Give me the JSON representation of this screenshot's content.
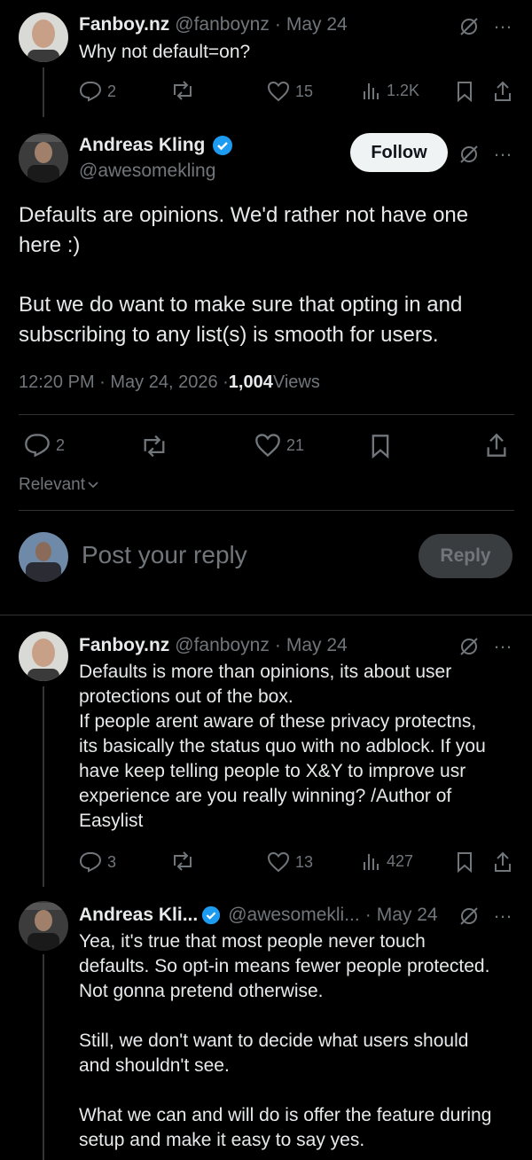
{
  "tweet1": {
    "name": "Fanboy.nz",
    "handle": "@fanboynz",
    "sep": "·",
    "date": "May 24",
    "text": "Why not default=on?",
    "replies": "2",
    "likes": "15",
    "views": "1.2K"
  },
  "main": {
    "name": "Andreas Kling",
    "handle": "@awesomekling",
    "follow_label": "Follow",
    "text_line1": "Defaults are opinions. We'd rather not have one",
    "text_line2": "here :)",
    "text_line3": "But we do want to make sure that opting in and",
    "text_line4": "subscribing to any list(s) is smooth for users.",
    "time": "12:20 PM · May 24, 2026 · ",
    "views_count": "1,004",
    "views_label": " Views",
    "replies": "2",
    "likes": "21"
  },
  "sort": {
    "label": "Relevant"
  },
  "composer": {
    "placeholder": "Post your reply",
    "reply_label": "Reply"
  },
  "tweet2": {
    "name": "Fanboy.nz",
    "handle": "@fanboynz",
    "sep": "·",
    "date": "May 24",
    "line1": "Defaults is more than opinions, its about user",
    "line2": "protections out of the box.",
    "line3": "If people arent aware of these privacy protectns,",
    "line4": "its basically the status quo with no adblock. If you",
    "line5": "have keep telling people to X&Y to improve usr",
    "line6": "experience are you really winning? /Author of",
    "line7": "Easylist",
    "replies": "3",
    "likes": "13",
    "views": "427"
  },
  "tweet3": {
    "name": "Andreas Kli...",
    "handle": "@awesomekli...",
    "sep": "·",
    "date": "May 24",
    "line1": "Yea, it's true that most people never touch",
    "line2": "defaults. So opt-in means fewer people protected.",
    "line3": "Not gonna pretend otherwise.",
    "line4": "Still, we don't want to decide what users should",
    "line5": "and shouldn't see.",
    "line6": "What we can and will do is offer the feature during",
    "line7": "setup and make it easy to say yes."
  },
  "icons": {
    "more": "…",
    "accent": "#1d9bf0"
  }
}
